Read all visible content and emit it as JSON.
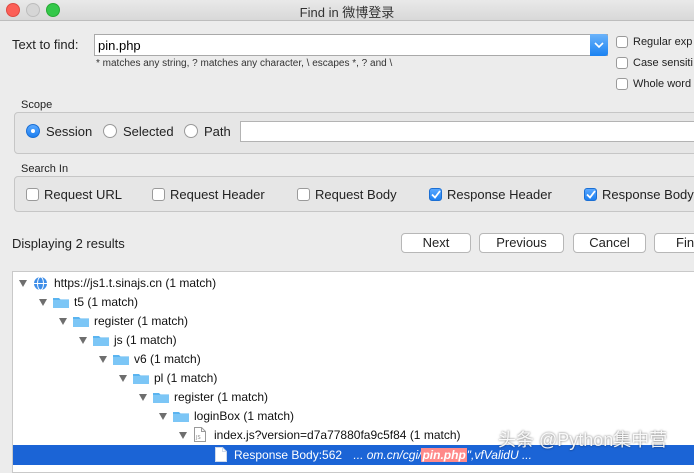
{
  "window": {
    "title": "Find in 微博登录"
  },
  "find": {
    "label": "Text to find:",
    "value": "pin.php",
    "hint": "* matches any string, ? matches any character, \\ escapes *, ? and \\"
  },
  "options": [
    {
      "label": "Regular exp",
      "checked": false
    },
    {
      "label": "Case sensiti",
      "checked": false
    },
    {
      "label": "Whole word",
      "checked": false
    }
  ],
  "scope": {
    "title": "Scope",
    "options": [
      {
        "label": "Session",
        "selected": true
      },
      {
        "label": "Selected",
        "selected": false
      },
      {
        "label": "Path",
        "selected": false
      }
    ],
    "path_value": ""
  },
  "search_in": {
    "title": "Search In",
    "options": [
      {
        "label": "Request URL",
        "checked": false
      },
      {
        "label": "Request Header",
        "checked": false
      },
      {
        "label": "Request Body",
        "checked": false
      },
      {
        "label": "Response Header",
        "checked": true
      },
      {
        "label": "Response Body",
        "checked": true
      }
    ]
  },
  "results": {
    "summary": "Displaying 2 results",
    "buttons": {
      "next": "Next",
      "previous": "Previous",
      "cancel": "Cancel",
      "find": "Fin"
    }
  },
  "tree": [
    {
      "label": "https://js1.t.sinajs.cn (1 match)",
      "icon": "globe-icon"
    },
    {
      "label": "t5 (1 match)",
      "icon": "folder-icon"
    },
    {
      "label": "register (1 match)",
      "icon": "folder-icon"
    },
    {
      "label": "js (1 match)",
      "icon": "folder-icon"
    },
    {
      "label": "v6 (1 match)",
      "icon": "folder-icon"
    },
    {
      "label": "pl (1 match)",
      "icon": "folder-icon"
    },
    {
      "label": "register (1 match)",
      "icon": "folder-icon"
    },
    {
      "label": "loginBox (1 match)",
      "icon": "folder-icon"
    },
    {
      "label": "index.js?version=d7a77880fa9c5f84 (1 match)",
      "icon": "file-icon"
    }
  ],
  "selected_result": {
    "prefix": "Response Body:562",
    "snippet_before": "... om.cn/cgi/",
    "match": "pin.php",
    "snippet_after": "\",vfValidU ..."
  },
  "watermark": {
    "text": "头条 @Python集中营"
  },
  "colors": {
    "accent": "#1d7ff0",
    "selection": "#1b64d6",
    "match_highlight": "#ff8a8a",
    "folder": "#5ab4f0"
  }
}
